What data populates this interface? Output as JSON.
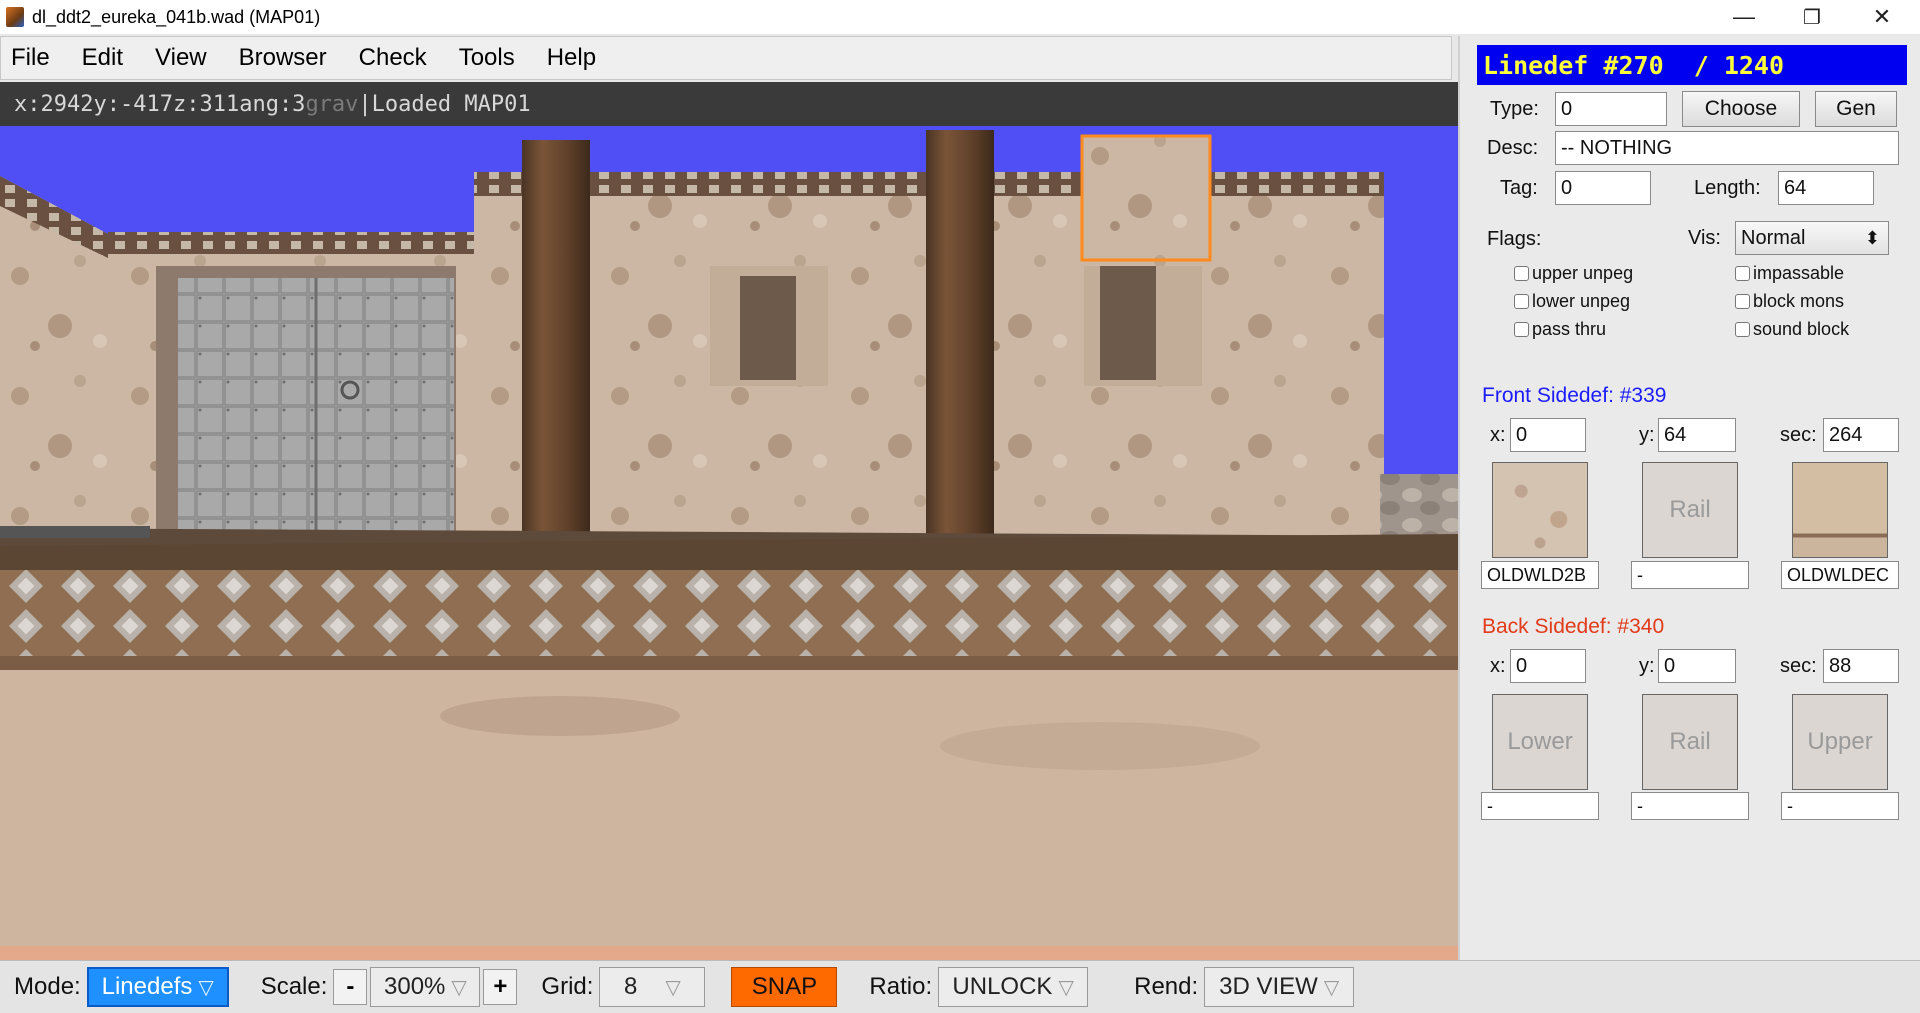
{
  "window": {
    "title": "dl_ddt2_eureka_041b.wad (MAP01)",
    "controls": {
      "minimize": "—",
      "maximize": "❐",
      "close": "✕"
    }
  },
  "menu": [
    "File",
    "Edit",
    "View",
    "Browser",
    "Check",
    "Tools",
    "Help"
  ],
  "status": {
    "x": "x:2942",
    "y": "y:-417",
    "z": "z:311",
    "ang": "ang:3",
    "grav": "grav",
    "sep": "|",
    "message": "Loaded MAP01"
  },
  "bottom": {
    "mode_label": "Mode:",
    "mode_value": "Linedefs",
    "scale_label": "Scale:",
    "scale_minus": "-",
    "scale_value": "300%",
    "scale_plus": "+",
    "grid_label": "Grid:",
    "grid_value": "8",
    "snap": "SNAP",
    "ratio_label": "Ratio:",
    "ratio_value": "UNLOCK",
    "rend_label": "Rend:",
    "rend_value": "3D VIEW",
    "dropdown_arrow": "▽"
  },
  "panel": {
    "header": "Linedef #270  / 1240",
    "type_label": "Type:",
    "type_value": "0",
    "choose": "Choose",
    "gen": "Gen",
    "desc_label": "Desc:",
    "desc_value": "-- NOTHING",
    "tag_label": "Tag:",
    "tag_value": "0",
    "length_label": "Length:",
    "length_value": "64",
    "flags_label": "Flags:",
    "vis_label": "Vis:",
    "vis_value": "Normal",
    "vis_arrow": "⬍",
    "flags_left": [
      "upper unpeg",
      "lower unpeg",
      "pass thru"
    ],
    "flags_right": [
      "impassable",
      "block mons",
      "sound block"
    ],
    "front": {
      "title": "Front Sidedef: #339",
      "x_label": "x:",
      "x": "0",
      "y_label": "y:",
      "y": "64",
      "sec_label": "sec:",
      "sec": "264",
      "lower_tex": "OLDWLD2B",
      "rail_label": "Rail",
      "rail_tex": "-",
      "upper_tex": "OLDWLDEC"
    },
    "back": {
      "title": "Back Sidedef: #340",
      "x_label": "x:",
      "x": "0",
      "y_label": "y:",
      "y": "0",
      "sec_label": "sec:",
      "sec": "88",
      "lower_label": "Lower",
      "rail_label": "Rail",
      "upper_label": "Upper",
      "lower_tex": "-",
      "rail_tex": "-",
      "upper_tex": "-"
    }
  },
  "colors": {
    "header_bg": "#0000f0",
    "header_text": "#ffff3a",
    "mode_active": "#1e90ff",
    "snap": "#ff6a00",
    "sky": "#4f4ff5",
    "selection": "#ff8a1e"
  }
}
